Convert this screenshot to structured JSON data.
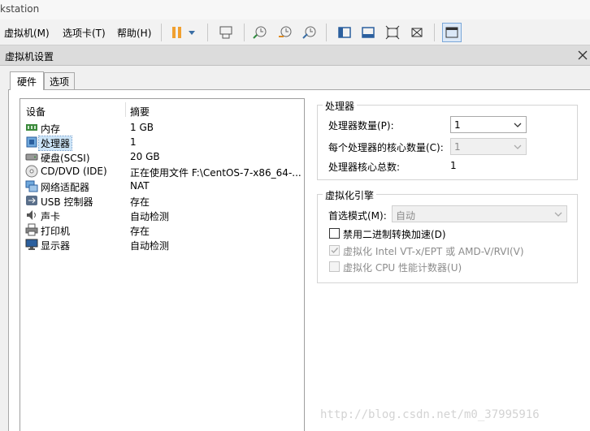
{
  "app": {
    "title": "kstation"
  },
  "menu": {
    "vm": "虚拟机(M)",
    "tabs": "选项卡(T)",
    "help": "帮助(H)"
  },
  "dialog": {
    "title": "虚拟机设置",
    "tabs": {
      "hardware": "硬件",
      "options": "选项"
    }
  },
  "device_list": {
    "headers": {
      "device": "设备",
      "summary": "摘要"
    },
    "rows": [
      {
        "name": "内存",
        "summary": "1 GB",
        "icon": "memory-icon"
      },
      {
        "name": "处理器",
        "summary": "1",
        "icon": "processor-icon",
        "selected": true
      },
      {
        "name": "硬盘(SCSI)",
        "summary": "20 GB",
        "icon": "hard-disk-icon"
      },
      {
        "name": "CD/DVD (IDE)",
        "summary": "正在使用文件 F:\\CentOS-7-x86_64-...",
        "icon": "cd-dvd-icon"
      },
      {
        "name": "网络适配器",
        "summary": "NAT",
        "icon": "network-adapter-icon"
      },
      {
        "name": "USB 控制器",
        "summary": "存在",
        "icon": "usb-icon"
      },
      {
        "name": "声卡",
        "summary": "自动检测",
        "icon": "sound-card-icon"
      },
      {
        "name": "打印机",
        "summary": "存在",
        "icon": "printer-icon"
      },
      {
        "name": "显示器",
        "summary": "自动检测",
        "icon": "display-icon"
      }
    ]
  },
  "processor": {
    "title": "处理器",
    "count_label": "处理器数量(P):",
    "count_value": "1",
    "cores_label": "每个处理器的核心数量(C):",
    "cores_value": "1",
    "total_label": "处理器核心总数:",
    "total_value": "1"
  },
  "virtualization": {
    "title": "虚拟化引擎",
    "mode_label": "首选模式(M):",
    "mode_value": "自动",
    "disable_binary": "禁用二进制转换加速(D)",
    "vtx": "虚拟化 Intel VT-x/EPT 或 AMD-V/RVI(V)",
    "cpu_counters": "虚拟化 CPU 性能计数器(U)"
  },
  "watermark": "http://blog.csdn.net/m0_37995916",
  "colors": {
    "selection": "#cce4f7",
    "accent": "#f0a030"
  }
}
